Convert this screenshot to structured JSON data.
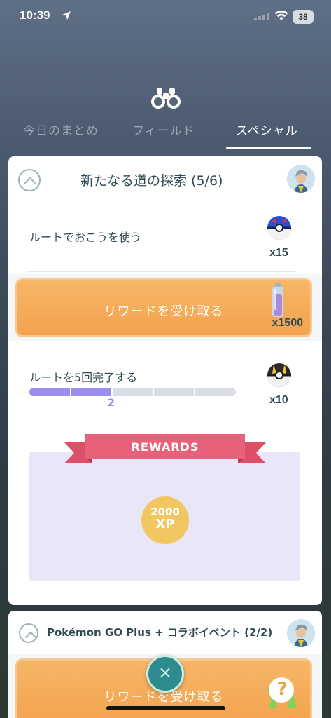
{
  "status": {
    "time": "10:39",
    "battery": "38"
  },
  "tabs": [
    {
      "label": "今日のまとめ"
    },
    {
      "label": "フィールド"
    },
    {
      "label": "スペシャル"
    }
  ],
  "research": {
    "title": "新たなる道の探索 (5/6)",
    "tasks": [
      {
        "label": "ルートでおこうを使う",
        "reward_icon": "great-ball-icon",
        "reward_count": "x15",
        "claim_label": "リワードを受け取る",
        "claim_reward_icon": "potion-icon",
        "claim_reward_count": "x1500"
      },
      {
        "label": "ルートを5回完了する",
        "reward_icon": "ultra-ball-icon",
        "reward_count": "x10",
        "progress_value": "2",
        "progress_fraction": 0.4
      }
    ],
    "rewards": {
      "banner": "REWARDS",
      "xp_amount": "2000",
      "xp_unit": "XP"
    }
  },
  "second_research": {
    "title": "Pokémon GO Plus + コラボイベント (2/2)",
    "claim_label": "リワードを受け取る"
  },
  "close_button": {
    "label": "×"
  },
  "help": {
    "label": "?"
  },
  "colors": {
    "accent_orange": "#f3a24e",
    "progress": "#9a8ef0",
    "xp_gold": "#f2c661",
    "ribbon_red": "#e8607a",
    "fab_teal": "#2e8c8e"
  }
}
